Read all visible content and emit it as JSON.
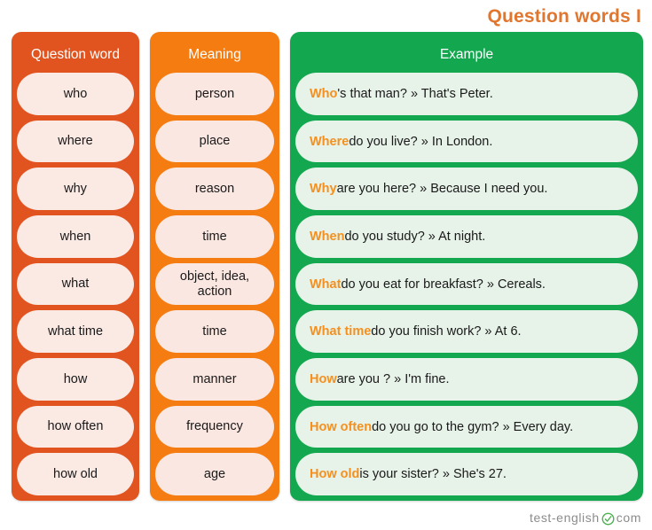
{
  "title": "Question words I",
  "headers": {
    "question_word": "Question word",
    "meaning": "Meaning",
    "example": "Example"
  },
  "colors": {
    "question_word_panel": "#e1541f",
    "meaning_panel": "#f47c10",
    "example_panel": "#13a84f",
    "cell_warm": "#fbe9e4",
    "cell_green": "#e7f2e9",
    "title_orange": "#e1762f",
    "keyword_orange": "#f5901e",
    "footer_gray": "#8b8b8b"
  },
  "rows": [
    {
      "question_word": "who",
      "meaning": "person",
      "example_keyword": "Who",
      "example_rest": "'s that man? » That's Peter.",
      "example_full": "Who's that man? » That's Peter."
    },
    {
      "question_word": "where",
      "meaning": "place",
      "example_keyword": "Where",
      "example_rest": " do you live? » In London.",
      "example_full": "Where do you live? » In London."
    },
    {
      "question_word": "why",
      "meaning": "reason",
      "example_keyword": "Why",
      "example_rest": " are you here? » Because I need you.",
      "example_full": "Why are you here? » Because I need you."
    },
    {
      "question_word": "when",
      "meaning": "time",
      "example_keyword": "When",
      "example_rest": " do you study? » At night.",
      "example_full": "When do you study? » At night."
    },
    {
      "question_word": "what",
      "meaning": "object, idea, action",
      "example_keyword": "What",
      "example_rest": " do you eat for breakfast? » Cereals.",
      "example_full": "What do you eat for breakfast? » Cereals."
    },
    {
      "question_word": "what time",
      "meaning": "time",
      "example_keyword": "What time",
      "example_rest": " do you finish work? » At 6.",
      "example_full": "What time do you finish work? » At 6."
    },
    {
      "question_word": "how",
      "meaning": "manner",
      "example_keyword": "How",
      "example_rest": " are you ? » I'm fine.",
      "example_full": "How are you ? » I'm fine."
    },
    {
      "question_word": "how often",
      "meaning": "frequency",
      "example_keyword": "How often",
      "example_rest": " do you go to the gym? » Every day.",
      "example_full": "How often do you go to the gym? » Every day."
    },
    {
      "question_word": "how old",
      "meaning": "age",
      "example_keyword": "How old",
      "example_rest": " is your sister? » She's 27.",
      "example_full": "How old is your sister? » She's 27."
    }
  ],
  "footer": {
    "brand_left": "test-english",
    "icon": "circle-check-icon",
    "brand_right": "com"
  }
}
